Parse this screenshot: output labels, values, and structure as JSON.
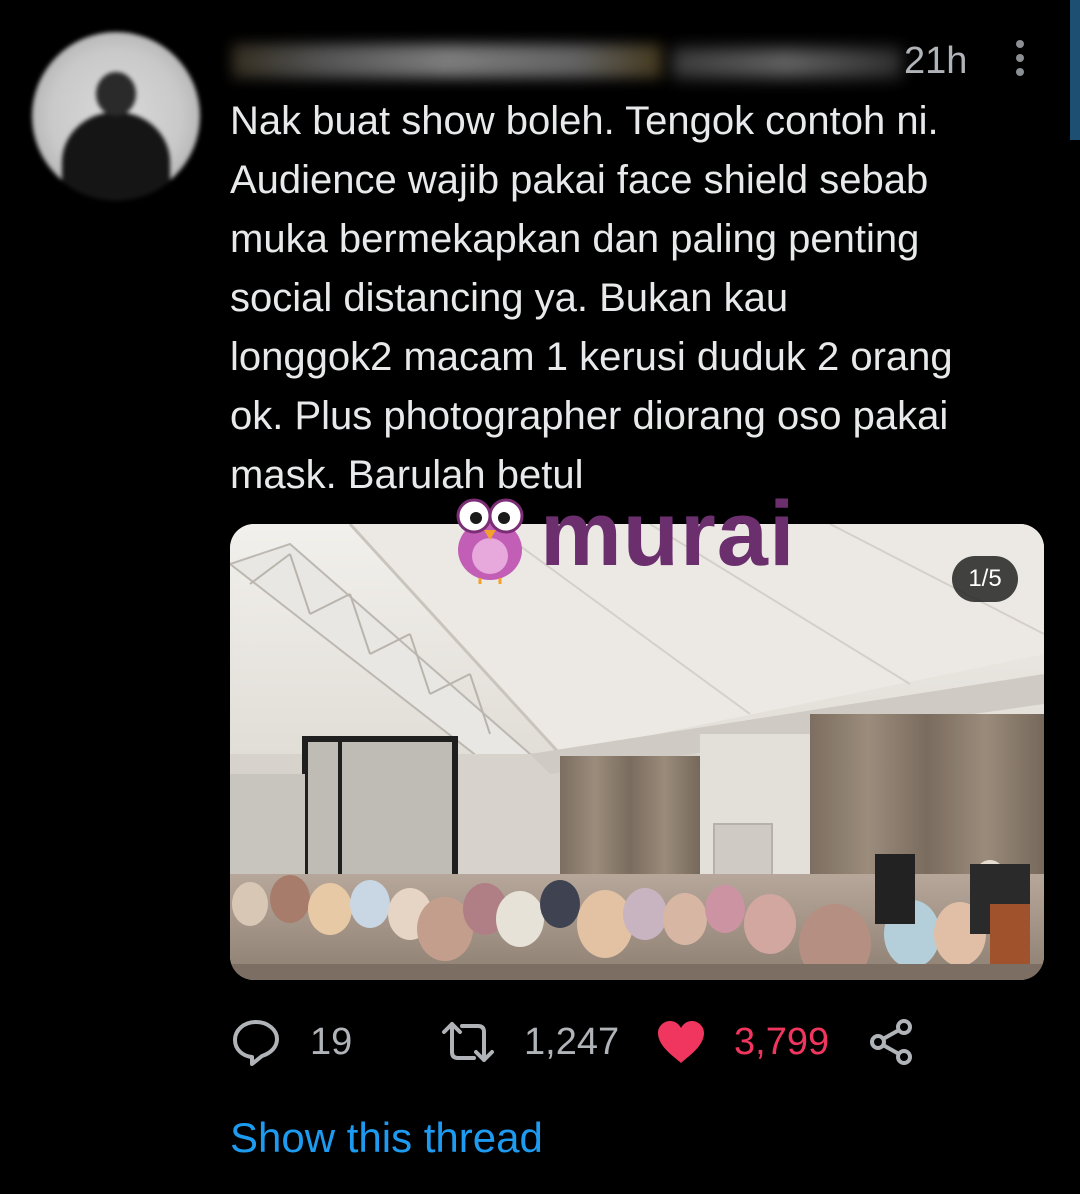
{
  "tweet": {
    "timestamp": "21h",
    "more_icon": "more-vertical-icon",
    "text": "Nak buat show boleh. Tengok contoh ni.\nAudience wajib pakai face shield sebab\nmuka bermekapkan dan paling penting\nsocial distancing ya. Bukan kau\nlonggok2 macam 1 kerusi duduk 2 orang\nok. Plus photographer diorang oso pakai\nmask. Barulah betul",
    "media": {
      "counter": "1/5"
    },
    "watermark": {
      "text": "murai"
    },
    "actions": {
      "reply_count": "19",
      "retweet_count": "1,247",
      "like_count": "3,799"
    },
    "show_thread_label": "Show this thread"
  },
  "colors": {
    "background": "#000000",
    "text": "#e7e9ea",
    "muted": "#b0b4b8",
    "like": "#f0365f",
    "link": "#1d9bf0",
    "watermark": "#6b2f6e"
  }
}
